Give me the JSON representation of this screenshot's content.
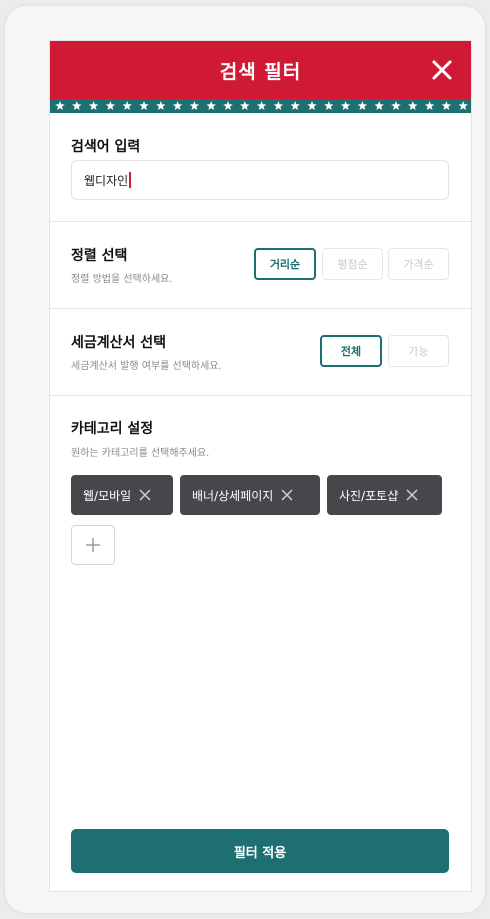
{
  "header": {
    "title": "검색 필터",
    "close_icon": "close-icon"
  },
  "search": {
    "label": "검색어 입력",
    "value": "웹디자인"
  },
  "sort": {
    "label": "정렬 선택",
    "desc": "정렬 방법을 선택하세요.",
    "options": [
      "거리순",
      "평점순",
      "가격순"
    ],
    "selected": "거리순"
  },
  "tax": {
    "label": "세금계산서 선택",
    "desc": "세금계산서 발행 여부를 선택하세요.",
    "options": [
      "전체",
      "가능"
    ],
    "selected": "전체"
  },
  "category": {
    "label": "카테고리 설정",
    "desc": "원하는 카테고리를 선택해주세요.",
    "chips": [
      "웹/모바일",
      "배너/상세페이지",
      "사진/포토샵"
    ],
    "add_icon": "plus-icon"
  },
  "apply_button": "필터 적용",
  "colors": {
    "header": "#d01a35",
    "accent": "#1e6f72",
    "chip": "#45474b"
  }
}
